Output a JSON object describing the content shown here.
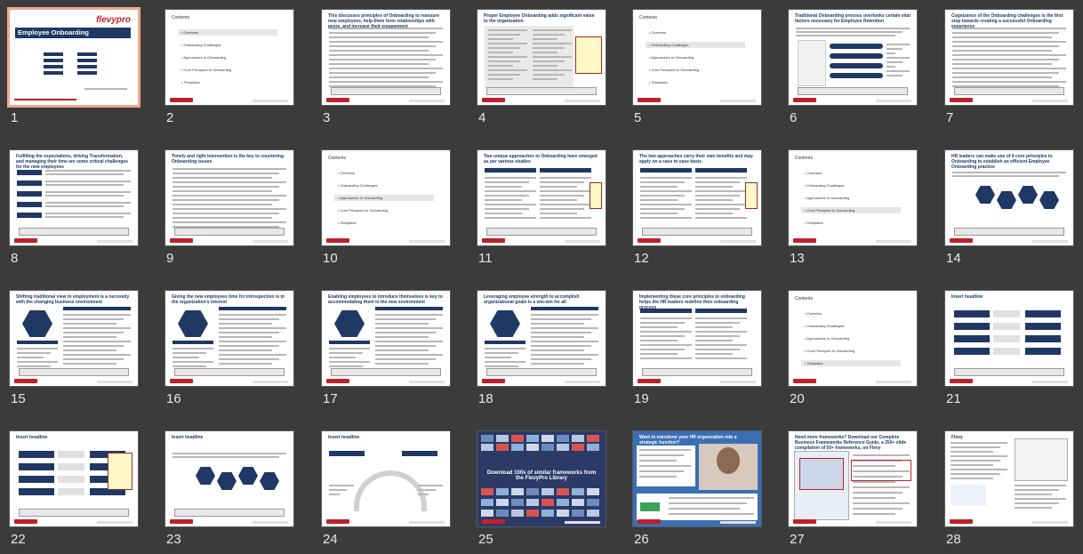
{
  "slides": [
    {
      "n": "1",
      "kind": "cover",
      "title": "Employee Onboarding",
      "brand": "flevypro",
      "selected": true
    },
    {
      "n": "2",
      "kind": "agenda",
      "title": "Contents"
    },
    {
      "n": "3",
      "kind": "text",
      "title": "This discusses principles of Onboarding to reassure new employees, help them form relationships with peers, and increase their engagement"
    },
    {
      "n": "4",
      "kind": "list",
      "title": "Proper Employee Onboarding adds significant value to the organization"
    },
    {
      "n": "5",
      "kind": "agenda",
      "title": "Contents"
    },
    {
      "n": "6",
      "kind": "diagram",
      "title": "Traditional Onboarding process overlooks certain vital factors necessary for Employee Retention"
    },
    {
      "n": "7",
      "kind": "text",
      "title": "Cognizance of the Onboarding challenges is the first step towards creating a successful Onboarding experience"
    },
    {
      "n": "8",
      "kind": "list",
      "title": "Fulfilling the expectations, driving Transformation, and managing their time are some critical challenges for the new employees"
    },
    {
      "n": "9",
      "kind": "text",
      "title": "Timely and right intervention is the key to countering Onboarding issues"
    },
    {
      "n": "10",
      "kind": "agenda",
      "title": "Contents"
    },
    {
      "n": "11",
      "kind": "table",
      "title": "Two unique approaches to Onboarding have emerged as per various studies"
    },
    {
      "n": "12",
      "kind": "table",
      "title": "The two approaches carry their own benefits and may apply on a case to case basis"
    },
    {
      "n": "13",
      "kind": "agenda",
      "title": "Contents"
    },
    {
      "n": "14",
      "kind": "hex",
      "title": "HR leaders can make use of 4 core principles to Onboarding to establish an efficient Employee Onboarding practice"
    },
    {
      "n": "15",
      "kind": "hexdetail",
      "title": "Shifting traditional view to employment is a necessity with the changing business environment"
    },
    {
      "n": "16",
      "kind": "hexdetail",
      "title": "Giving the new employees time for introspection is in the organization's interest"
    },
    {
      "n": "17",
      "kind": "hexdetail",
      "title": "Enabling employees to introduce themselves is key to accommodating them in the new environment"
    },
    {
      "n": "18",
      "kind": "hexdetail",
      "title": "Leveraging employee strength to accomplish organizational goals is a win-win for all"
    },
    {
      "n": "19",
      "kind": "table",
      "title": "Implementing these core principles to onboarding helps the HR leaders redefine their onboarding process"
    },
    {
      "n": "20",
      "kind": "agenda",
      "title": "Contents"
    },
    {
      "n": "21",
      "kind": "arrows",
      "title": "Insert headline"
    },
    {
      "n": "22",
      "kind": "arrows",
      "title": "Insert headline"
    },
    {
      "n": "23",
      "kind": "hex",
      "title": "Insert headline"
    },
    {
      "n": "24",
      "kind": "arc",
      "title": "Insert headline"
    },
    {
      "n": "25",
      "kind": "library",
      "title": "Download 100s of similar frameworks from the FlevyPro Library"
    },
    {
      "n": "26",
      "kind": "photo",
      "title": "Want to transform your HR organization into a strategic function?"
    },
    {
      "n": "27",
      "kind": "guide",
      "title": "Need more frameworks? Download our Complete Business Frameworks Reference Guide, a 250+ slide compilation of 50+ frameworks, on Flevy"
    },
    {
      "n": "28",
      "kind": "closing",
      "title": "Flevy"
    }
  ],
  "agenda_items": [
    "Overview",
    "Onboarding Challenges",
    "Approaches to Onboarding",
    "Core Principles to Onboarding",
    "Templates"
  ]
}
